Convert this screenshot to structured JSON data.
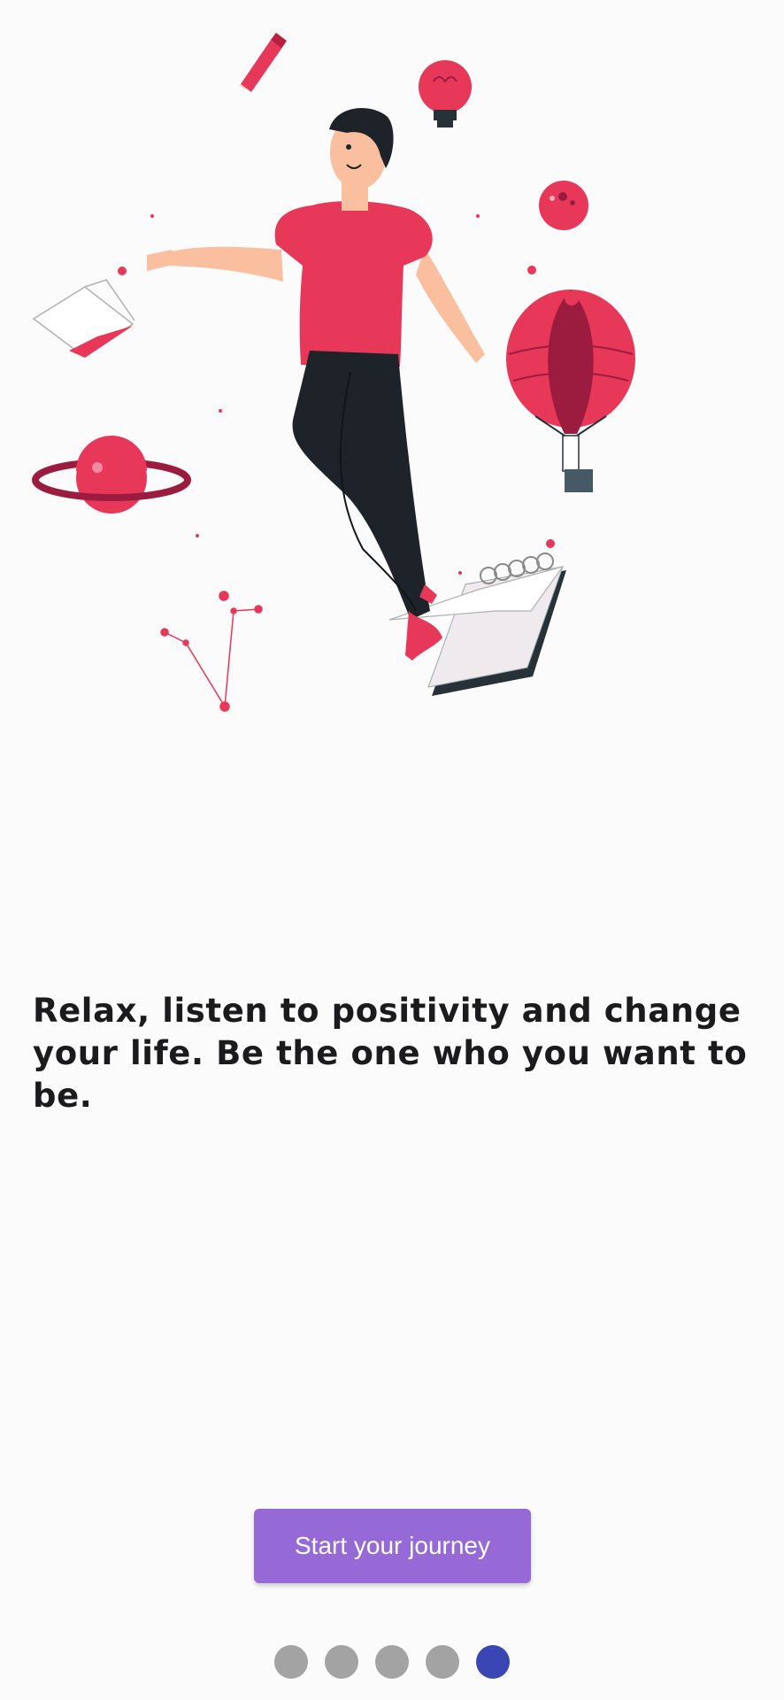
{
  "onboarding": {
    "headline": "Relax, listen to positivity and change\nyour life. Be the one who you want to be.",
    "cta_label": "Start your journey",
    "page_indicator": {
      "total": 5,
      "current": 5
    }
  },
  "colors": {
    "background": "#fafbfa",
    "accent_red": "#e8385a",
    "dark_red": "#9c1c40",
    "button": "#9569d6",
    "dot_inactive": "#a3a3a3",
    "dot_active": "#3a46b4",
    "text": "#1b1b1d"
  },
  "illustration": {
    "subject": "man-floating-with-balloon-planet-book",
    "icons": [
      "pencil-icon",
      "lightbulb-icon",
      "ball-icon",
      "hot-air-balloon-icon",
      "planet-icon",
      "open-book-icon",
      "notebook-icon",
      "constellation-icon"
    ]
  }
}
